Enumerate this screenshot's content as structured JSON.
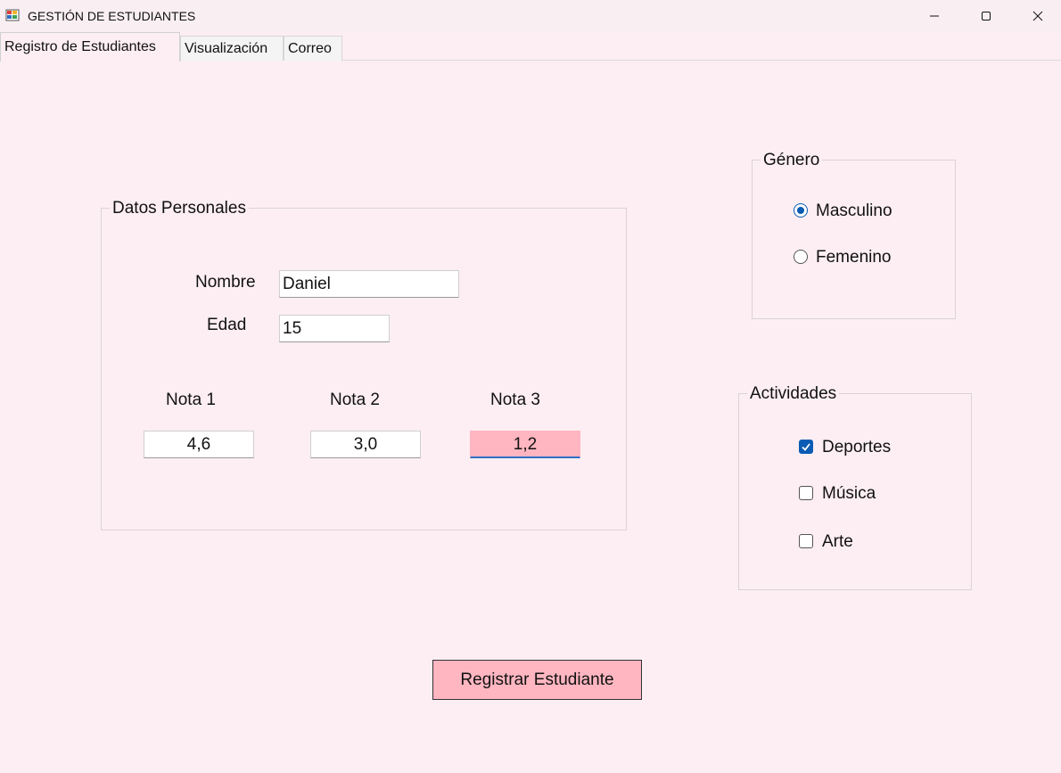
{
  "window": {
    "title": "GESTIÓN DE ESTUDIANTES",
    "controls": {
      "minimize_icon": "minimize-icon",
      "maximize_icon": "maximize-icon",
      "close_icon": "close-icon"
    }
  },
  "tabs": [
    {
      "label": "Registro de Estudiantes",
      "active": true
    },
    {
      "label": "Visualización",
      "active": false
    },
    {
      "label": "Correo",
      "active": false
    }
  ],
  "datos_personales": {
    "title": "Datos Personales",
    "nombre": {
      "label": "Nombre",
      "value": "Daniel"
    },
    "edad": {
      "label": "Edad",
      "value": "15"
    },
    "notas": [
      {
        "label": "Nota 1",
        "value": "4,6",
        "invalid": false
      },
      {
        "label": "Nota 2",
        "value": "3,0",
        "invalid": false
      },
      {
        "label": "Nota 3",
        "value": "1,2",
        "invalid": true
      }
    ]
  },
  "genero": {
    "title": "Género",
    "options": [
      {
        "label": "Masculino",
        "checked": true
      },
      {
        "label": "Femenino",
        "checked": false
      }
    ]
  },
  "actividades": {
    "title": "Actividades",
    "options": [
      {
        "label": "Deportes",
        "checked": true
      },
      {
        "label": "Música",
        "checked": false
      },
      {
        "label": "Arte",
        "checked": false
      }
    ]
  },
  "submit_label": "Registrar Estudiante",
  "colors": {
    "background": "#fdeef3",
    "button": "#ffb6c1",
    "invalid_field": "#ffb6c1",
    "accent": "#0a5bb4"
  }
}
